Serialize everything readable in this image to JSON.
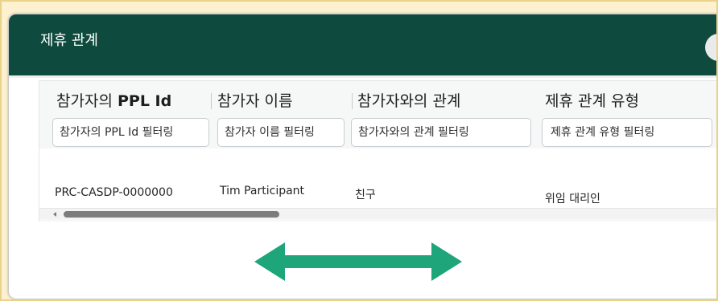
{
  "panel": {
    "title": "제휴 관계"
  },
  "table": {
    "columns": [
      {
        "label_prefix": "참가자의 ",
        "label_bold": "PPL Id",
        "filter_placeholder": "참가자의 PPL Id 필터링"
      },
      {
        "label": "참가자 이름",
        "filter_placeholder": "참가자 이름 필터링"
      },
      {
        "label": "참가자와의 관계",
        "filter_placeholder": "참가자와의 관계 필터링"
      },
      {
        "label": "제휴 관계 유형",
        "filter_placeholder": "제휴 관계 유형 필터링"
      }
    ],
    "rows": [
      {
        "ppl_id": "PRC-CASDP-0000000",
        "name": "Tim Participant",
        "relationship": "친구",
        "type": "위임 대리인"
      }
    ]
  },
  "scroll_hint": {
    "icon": "double-headed-arrow-icon",
    "color": "#1ea57a"
  },
  "colors": {
    "header_bg": "#0e4a3d",
    "page_bg": "#fdf1cf"
  }
}
